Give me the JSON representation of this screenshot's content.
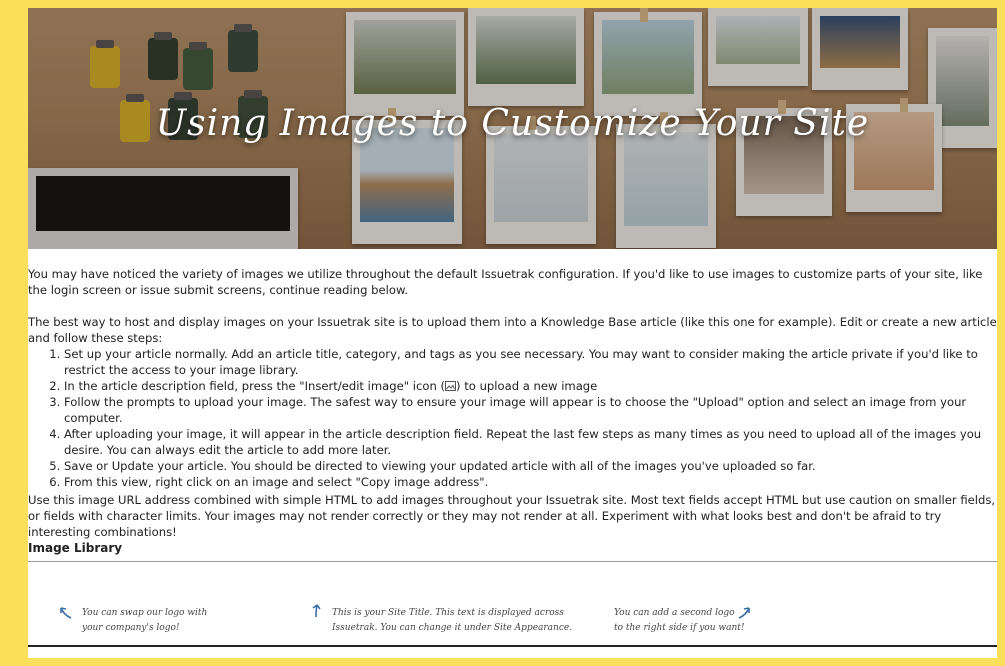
{
  "hero": {
    "title": "Using Images to Customize Your Site"
  },
  "article": {
    "intro": "You may have noticed the variety of images we utilize throughout the default Issuetrak configuration. If you'd like to use images to customize parts of your site, like the login screen or issue submit screens, continue reading below.",
    "para2": "The best way to host and display images on your Issuetrak site is to upload them into a Knowledge Base article (like this one for example). Edit or create a new article and follow these steps:",
    "steps": [
      "Set up your article normally. Add an article title, category, and tags as you see necessary. You may want to consider making the article private if you'd like to restrict the access to your image library.",
      "In the article description field, press the \"Insert/edit image\" icon (",
      "Follow the prompts to upload your image. The safest way to ensure your image will appear is to choose the \"Upload\" option and select an image from your computer.",
      "After uploading your image, it will appear in the article description field. Repeat the last few steps as many times as you need to upload all of the images you desire. You can always edit the article to add more later.",
      "Save or Update your article. You should be directed to viewing your updated article with all of the images you've uploaded so far.",
      "From this view, right click on an image and select \"Copy image address\"."
    ],
    "step2_tail": ") to upload a new image",
    "para3": "Use this image URL address combined with simple HTML to add images throughout your Issuetrak site. Most text fields accept HTML but use caution on smaller fields, or fields with character limits. Your images may not render correctly or they may not render at all. Experiment with what looks best and don't be afraid to try interesting combinations!",
    "library_heading": "Image Library",
    "notes": {
      "logo_1": "You can swap our logo with",
      "logo_2": "your company's logo!",
      "title_1": "This is your Site Title. This text is displayed across",
      "title_2": "Issuetrak. You can change it under Site Appearance.",
      "logo2_1": "You can add a second logo",
      "logo2_2": "to the right side if you want!"
    }
  },
  "colors": {
    "frame": "#f9df5a",
    "hero_text": "#ffffff",
    "arrow": "#3a6ea5"
  },
  "icons": [
    "insert-image-icon",
    "arrow-up-left-icon",
    "arrow-up-right-icon"
  ]
}
